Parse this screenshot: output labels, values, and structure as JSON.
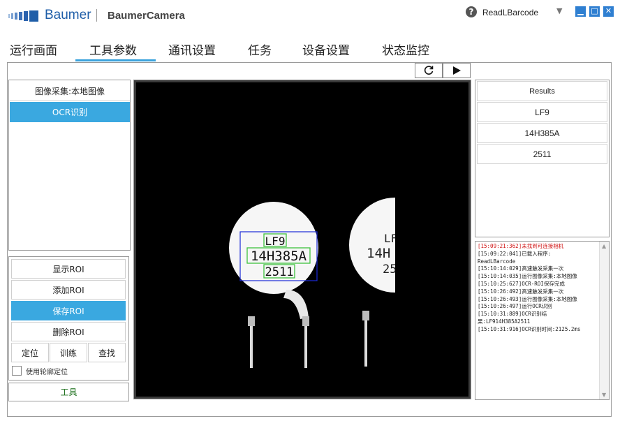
{
  "header": {
    "brand": "Baumer",
    "app_title": "BaumerCamera",
    "help_icon": "?",
    "program_name": "ReadLBarcode",
    "dropdown": "▼",
    "window_controls": {
      "minimize": "▁",
      "maximize": "□",
      "close": "✕"
    }
  },
  "tabs": [
    {
      "label": "运行画面"
    },
    {
      "label": "工具参数"
    },
    {
      "label": "通讯设置"
    },
    {
      "label": "任务"
    },
    {
      "label": "设备设置"
    },
    {
      "label": "状态监控"
    }
  ],
  "active_tab": "工具参数",
  "steps": [
    {
      "label": "图像采集:本地图像"
    },
    {
      "label": "OCR识别"
    }
  ],
  "roi": {
    "show": "显示ROI",
    "add": "添加ROI",
    "save": "保存ROI",
    "delete": "删除ROI",
    "locate": "定位",
    "train": "训练",
    "find": "查找",
    "contour_checkbox_label": "使用轮廓定位"
  },
  "tools_button": "工具",
  "image": {
    "lines": [
      "LF9",
      "14H385A",
      "2511"
    ],
    "partial_lines": [
      "LF",
      "14H",
      "25"
    ]
  },
  "results": {
    "header": "Results",
    "rows": [
      "LF9",
      "14H385A",
      "2511"
    ]
  },
  "log": [
    {
      "text": "[15:09:21:362]未找到可连接相机",
      "error": true
    },
    {
      "text": "[15:09:22:041]已载入程序:",
      "error": false
    },
    {
      "text": "ReadLBarcode",
      "error": false
    },
    {
      "text": "[15:10:14:029]高速触发采集一次",
      "error": false
    },
    {
      "text": "[15:10:14:035]运行图像采集:本地图像",
      "error": false
    },
    {
      "text": "[15:10:25:627]OCR-ROI保存完成",
      "error": false
    },
    {
      "text": "[15:10:26:492]高速触发采集一次",
      "error": false
    },
    {
      "text": "[15:10:26:493]运行图像采集:本地图像",
      "error": false
    },
    {
      "text": "[15:10:26:497]运行OCR识别",
      "error": false
    },
    {
      "text": "[15:10:31:889]OCR识别结",
      "error": false
    },
    {
      "text": "果:LF914H385A2511",
      "error": false
    },
    {
      "text": "[15:10:31:916]OCR识别时间:2125.2ms",
      "error": false
    }
  ],
  "colors": {
    "accent": "#3aa8e0",
    "brand": "#1f5ea8",
    "ocr_box": "#3ec23e",
    "roi_box": "#1a2ad8"
  }
}
